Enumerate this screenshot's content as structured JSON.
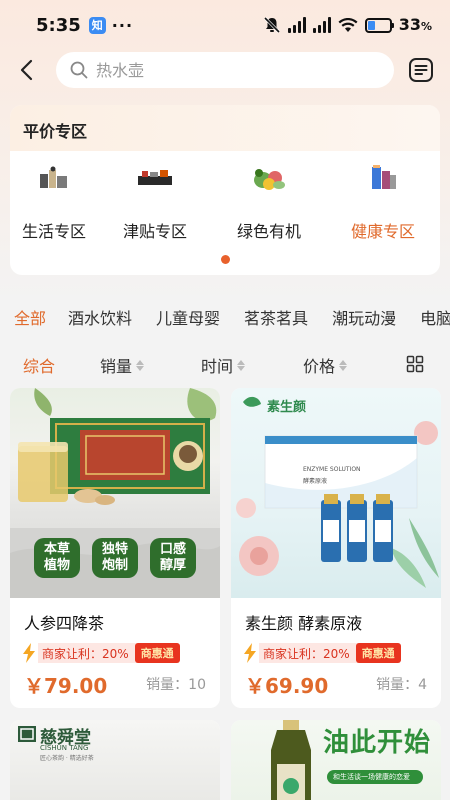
{
  "status_bar": {
    "time": "5:35",
    "app_badge": "知",
    "more": "···",
    "battery_pct": "33",
    "battery_unit": "%",
    "battery_level": 0.33
  },
  "search": {
    "placeholder": "热水壶"
  },
  "zone": {
    "title": "平价专区",
    "items": [
      {
        "label": "生活专区",
        "icon": "daily-goods-icon"
      },
      {
        "label": "津贴专区",
        "icon": "subsidy-goods-icon"
      },
      {
        "label": "绿色有机",
        "icon": "vegetables-icon"
      },
      {
        "label": "健康专区",
        "icon": "health-goods-icon"
      }
    ]
  },
  "categories": [
    "全部",
    "酒水饮料",
    "儿童母婴",
    "茗茶茗具",
    "潮玩动漫",
    "电脑"
  ],
  "sort": {
    "comprehensive": "综合",
    "sales": "销量",
    "time": "时间",
    "price": "价格"
  },
  "products": [
    {
      "name": "人参四降茶",
      "promo": "商家让利：20%",
      "badge": "商惠通",
      "price": "￥79.00",
      "sales": "销量：10",
      "image_text": [
        "本草植物",
        "独特炮制",
        "口感醇厚"
      ]
    },
    {
      "name": "素生颜 酵素原液",
      "promo": "商家让利：20%",
      "badge": "商惠通",
      "price": "￥69.90",
      "sales": "销量：4",
      "brand": "素生颜",
      "box_text": "ENZYME SOLUTION",
      "box_sub": "酵素原液"
    }
  ],
  "bottom_products": [
    {
      "brand": "慈舜堂",
      "brand_en": "CISHUN TANG",
      "slogan": "匠心茶韵 · 精选好茶"
    },
    {
      "headline": "油此开始",
      "subline": "和生活谈一场健康的恋爱"
    }
  ],
  "colors": {
    "accent": "#e06a2c",
    "promo_red": "#e8341f"
  }
}
